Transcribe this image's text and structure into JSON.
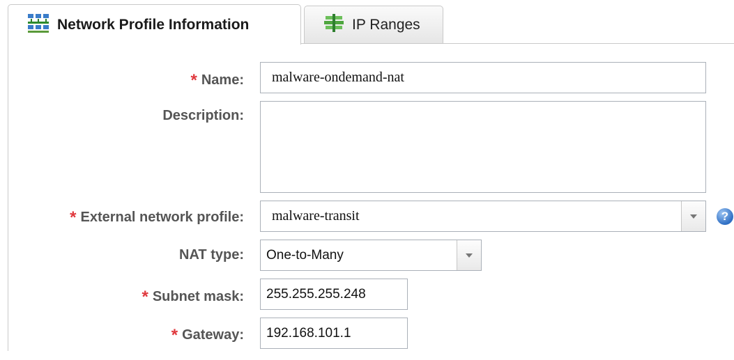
{
  "tabs": {
    "active_label": "Network Profile Information",
    "inactive_label": "IP Ranges"
  },
  "form": {
    "required_marker": "*",
    "name": {
      "label": "Name:",
      "value": "malware-ondemand-nat"
    },
    "description": {
      "label": "Description:",
      "value": ""
    },
    "external_network_profile": {
      "label": "External network profile:",
      "value": "malware-transit"
    },
    "nat_type": {
      "label": "NAT type:",
      "value": "One-to-Many"
    },
    "subnet_mask": {
      "label": "Subnet mask:",
      "value": "255.255.255.248"
    },
    "gateway": {
      "label": "Gateway:",
      "value": "192.168.101.1"
    },
    "help_glyph": "?"
  },
  "icons": {
    "network_profile_tab": "network-grid-icon",
    "ip_ranges_tab": "ip-range-stack-icon",
    "help": "help-icon",
    "dropdown": "chevron-down-icon"
  },
  "colors": {
    "required": "#e0393e",
    "label_text": "#555555",
    "border": "#aab0b8",
    "help_blue": "#2f6fc4"
  }
}
